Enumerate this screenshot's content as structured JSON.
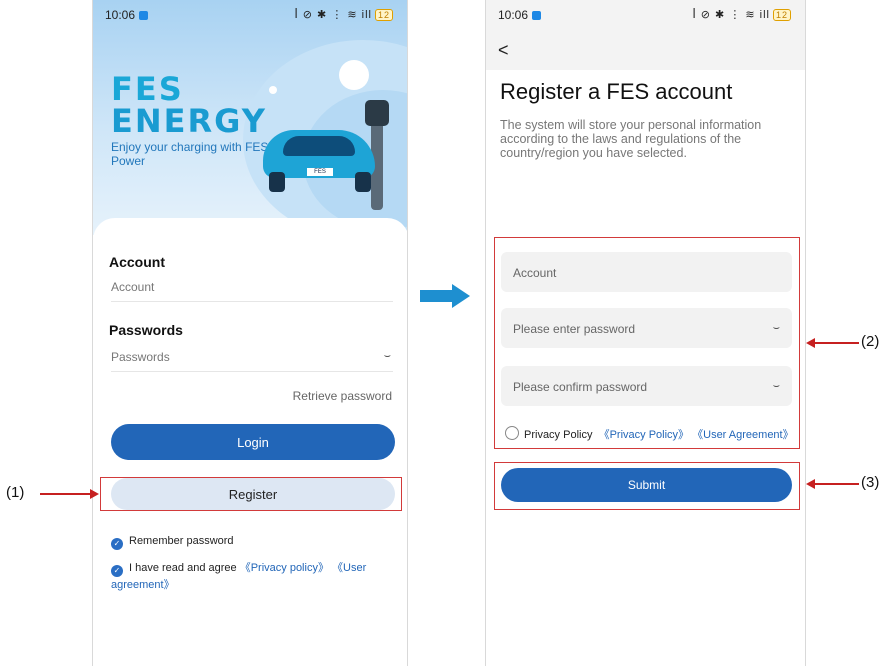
{
  "status_bar": {
    "time": "10:06",
    "icons": "ꟾ ⊘ ✱ ⋮ ≋ ill",
    "battery": "12"
  },
  "login_screen": {
    "logo_line1": "FES",
    "logo_line2": "ENERGY",
    "tagline": "Enjoy your charging with FES Power",
    "car_plate": "FES",
    "account_label": "Account",
    "account_placeholder": "Account",
    "password_label": "Passwords",
    "password_placeholder": "Passwords",
    "retrieve_password": "Retrieve password",
    "login_button": "Login",
    "register_button": "Register",
    "remember_password": "Remember password",
    "agree_text": "I have read and agree",
    "privacy_link": "《Privacy policy》",
    "user_agreement_link": "《User agreement》"
  },
  "register_screen": {
    "back": "<",
    "title": "Register a FES account",
    "subtitle": "The system will store your personal information according to the laws and regulations of the country/region you have selected.",
    "account_placeholder": "Account",
    "password_placeholder": "Please enter password",
    "confirm_placeholder": "Please confirm password",
    "privacy_label": "Privacy Policy",
    "privacy_link": "《Privacy Policy》",
    "user_agreement_link": "《User Agreement》",
    "submit_button": "Submit"
  },
  "callouts": {
    "one": "(1)",
    "two": "(2)",
    "three": "(3)"
  },
  "icons": {
    "eye": "eye-closed-icon",
    "check": "check-circle-icon"
  },
  "colors": {
    "primary": "#2266b8",
    "highlight": "#d23a3a",
    "arrow": "#1e8fd0"
  }
}
